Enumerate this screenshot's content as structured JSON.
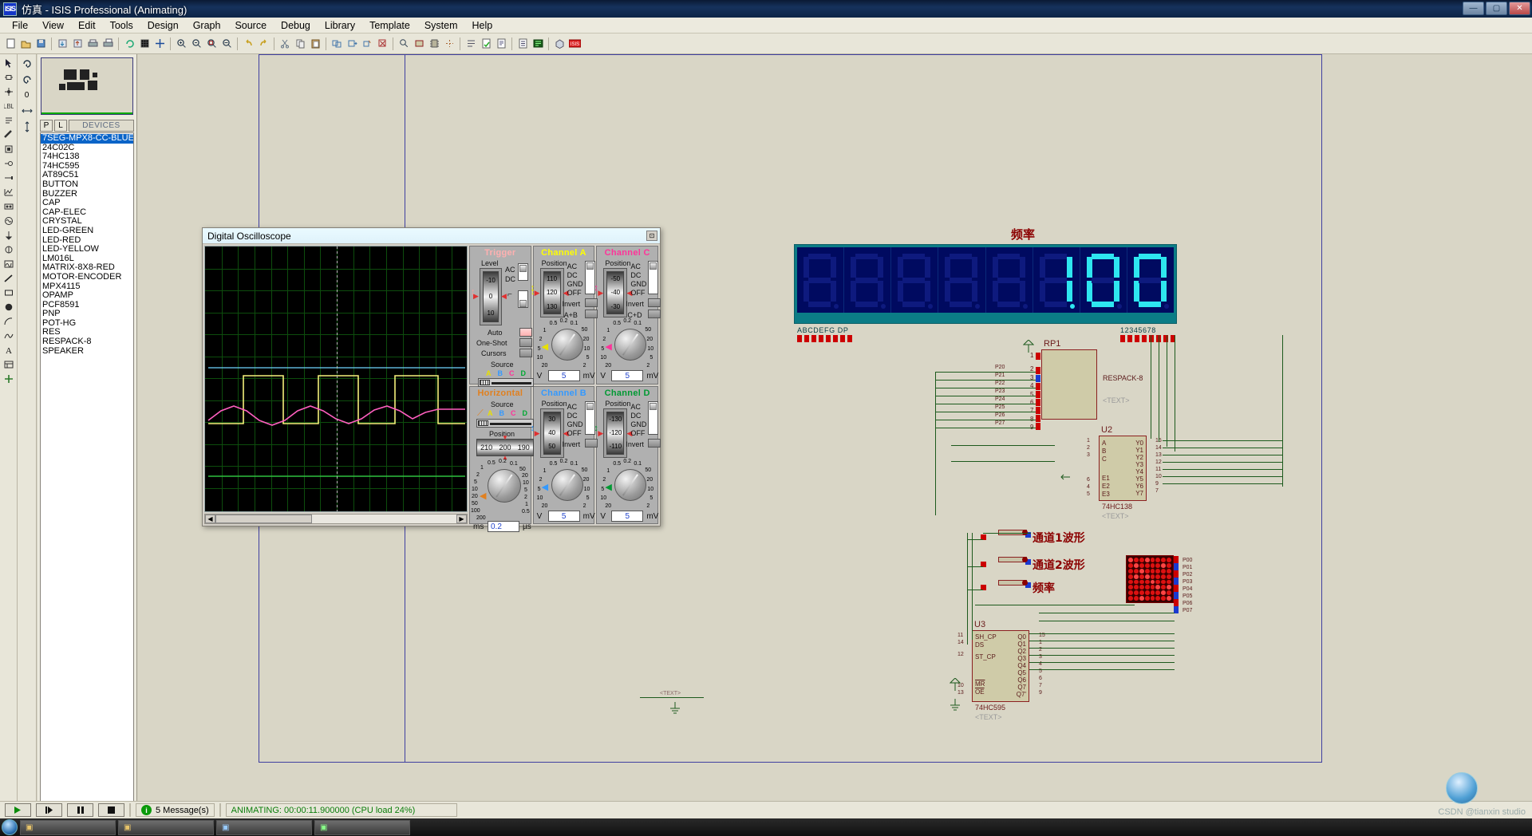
{
  "window": {
    "title": "仿真 - ISIS Professional (Animating)",
    "app_icon": "isis-icon",
    "minimize": "—",
    "maximize": "▢",
    "close": "✕"
  },
  "menubar": {
    "items": [
      "File",
      "View",
      "Edit",
      "Tools",
      "Design",
      "Graph",
      "Source",
      "Debug",
      "Library",
      "Template",
      "System",
      "Help"
    ]
  },
  "toolbar": {
    "groups": [
      [
        "new-file-icon",
        "open-file-icon",
        "save-file-icon"
      ],
      [
        "import-icon",
        "export-icon",
        "print-icon",
        "print-area-icon"
      ],
      [
        "refresh-icon",
        "grid-icon",
        "origin-icon"
      ],
      [
        "zoom-in-icon",
        "zoom-out-icon",
        "zoom-area-icon",
        "zoom-all-icon"
      ],
      [
        "undo-icon",
        "redo-icon"
      ],
      [
        "cut-icon",
        "copy-icon",
        "paste-icon"
      ],
      [
        "block-copy-icon",
        "block-move-icon",
        "block-rotate-icon",
        "block-delete-icon"
      ],
      [
        "pick-device-icon",
        "make-device-icon",
        "packaging-icon",
        "decompose-icon"
      ],
      [
        "netlist-icon",
        "electrical-check-icon",
        "netlist-compile-icon"
      ],
      [
        "bom-icon",
        "ares-icon",
        "help-icon"
      ],
      [
        "3d-view-icon",
        "isis-logo-icon"
      ]
    ]
  },
  "left_toolstrip": {
    "items": [
      "selection-mode-icon",
      "component-mode-icon",
      "junction-dot-icon",
      "wire-label-icon",
      "text-script-icon",
      "bus-icon",
      "subcircuit-icon",
      "terminals-mode-icon",
      "device-pin-icon",
      "graph-mode-icon",
      "tape-recorder-icon",
      "generator-mode-icon",
      "voltage-probe-icon",
      "current-probe-icon",
      "virtual-instrument-icon",
      "line-tool-icon",
      "box-tool-icon",
      "circle-tool-icon",
      "arc-tool-icon",
      "path-tool-icon",
      "text-tool-icon",
      "symbol-tool-icon",
      "marker-tool-icon"
    ],
    "orient_items": [
      "rotate-cw-icon",
      "rotate-ccw-icon",
      "rotation-value",
      "mirror-x-icon",
      "mirror-y-icon"
    ],
    "rotation_value": "0"
  },
  "devices_panel": {
    "header": {
      "p_button": "P",
      "l_button": "L",
      "title": "DEVICES"
    },
    "items": [
      {
        "label": "7SEG-MPX8-CC-BLUE",
        "selected": true
      },
      {
        "label": "24C02C",
        "selected": false
      },
      {
        "label": "74HC138",
        "selected": false
      },
      {
        "label": "74HC595",
        "selected": false
      },
      {
        "label": "AT89C51",
        "selected": false
      },
      {
        "label": "BUTTON",
        "selected": false
      },
      {
        "label": "BUZZER",
        "selected": false
      },
      {
        "label": "CAP",
        "selected": false
      },
      {
        "label": "CAP-ELEC",
        "selected": false
      },
      {
        "label": "CRYSTAL",
        "selected": false
      },
      {
        "label": "LED-GREEN",
        "selected": false
      },
      {
        "label": "LED-RED",
        "selected": false
      },
      {
        "label": "LED-YELLOW",
        "selected": false
      },
      {
        "label": "LM016L",
        "selected": false
      },
      {
        "label": "MATRIX-8X8-RED",
        "selected": false
      },
      {
        "label": "MOTOR-ENCODER",
        "selected": false
      },
      {
        "label": "MPX4115",
        "selected": false
      },
      {
        "label": "OPAMP",
        "selected": false
      },
      {
        "label": "PCF8591",
        "selected": false
      },
      {
        "label": "PNP",
        "selected": false
      },
      {
        "label": "POT-HG",
        "selected": false
      },
      {
        "label": "RES",
        "selected": false
      },
      {
        "label": "RESPACK-8",
        "selected": false
      },
      {
        "label": "SPEAKER",
        "selected": false
      }
    ]
  },
  "schematic": {
    "display_label": "频率",
    "seven_seg": {
      "value": "100",
      "digit_count": 8,
      "pin_label_left": "ABCDEFG DP",
      "pin_label_right": "12345678"
    },
    "labels": [
      {
        "text": "通道1波形"
      },
      {
        "text": "通道2波形"
      },
      {
        "text": "频率"
      }
    ],
    "components": [
      {
        "ref": "RP1",
        "type": "RESPACK-8",
        "text": "<TEXT>",
        "left_pins": [
          "1",
          "2",
          "3",
          "4",
          "5",
          "6",
          "7",
          "8",
          "9"
        ],
        "net_labels": [
          "P20",
          "P21",
          "P22",
          "P23",
          "P24",
          "P25",
          "P26",
          "P27"
        ]
      },
      {
        "ref": "U2",
        "type": "74HC138",
        "text": "<TEXT>",
        "in_pins": [
          "A",
          "B",
          "C",
          "E1",
          "E2",
          "E3"
        ],
        "in_nums": [
          "1",
          "2",
          "3",
          "6",
          "4",
          "5"
        ],
        "out_pins": [
          "Y0",
          "Y1",
          "Y2",
          "Y3",
          "Y4",
          "Y5",
          "Y6",
          "Y7"
        ],
        "out_nums": [
          "15",
          "14",
          "13",
          "12",
          "11",
          "10",
          "9",
          "7"
        ]
      },
      {
        "ref": "U3",
        "type": "74HC595",
        "text": "<TEXT>",
        "in_pins": [
          "SH_CP",
          "DS",
          "ST_CP",
          "MR",
          "OE"
        ],
        "in_nums": [
          "11",
          "14",
          "12",
          "10",
          "13"
        ],
        "out_pins": [
          "Q0",
          "Q1",
          "Q2",
          "Q3",
          "Q4",
          "Q5",
          "Q6",
          "Q7",
          "Q7'"
        ],
        "out_nums": [
          "15",
          "1",
          "2",
          "3",
          "4",
          "5",
          "6",
          "7",
          "9"
        ]
      }
    ],
    "net_labels_right": [
      "P00",
      "P01",
      "P02",
      "P03",
      "P04",
      "P05",
      "P06",
      "P07"
    ]
  },
  "oscilloscope": {
    "title": "Digital Oscilloscope",
    "close_button": "⊡",
    "screen": {
      "grid_cols": 16,
      "grid_rows": 12,
      "trace_colors": {
        "channel_a": "#f5f07a",
        "channel_b": "#6fd6ff",
        "channel_c": "#ff5fc0",
        "channel_d": "#2fbf3f"
      }
    },
    "trigger": {
      "header": "Trigger",
      "level_label": "Level",
      "level_ticks": [
        "-10",
        "0",
        "10"
      ],
      "coupling": [
        "AC",
        "DC"
      ],
      "auto_label": "Auto",
      "one_shot_label": "One-Shot",
      "cursors_label": "Cursors",
      "source_label": "Source",
      "source_channels": [
        "A",
        "B",
        "C",
        "D"
      ]
    },
    "horizontal": {
      "header": "Horizontal",
      "source_label": "Source",
      "source_channels": [
        "A",
        "B",
        "C",
        "D"
      ],
      "position_label": "Position",
      "position_ticks": [
        "210",
        "200",
        "190"
      ],
      "unit_left": "ms",
      "value": "0.2",
      "unit_right": "µs",
      "knob_scale": [
        "0.5",
        "0.2",
        "0.1",
        "1",
        "2",
        "5",
        "10",
        "20",
        "50",
        "100",
        "200",
        "50",
        "20",
        "10",
        "5",
        "2",
        "1",
        "0.5"
      ]
    },
    "channels": [
      {
        "name": "Channel A",
        "color": "#ffff00",
        "position_label": "Position",
        "position_ticks": [
          "110",
          "120",
          "130"
        ],
        "coupling": [
          "AC",
          "DC",
          "GND",
          "OFF"
        ],
        "invert_label": "Invert",
        "extra_label": "A+B",
        "unit_left": "V",
        "value": "5",
        "unit_right": "mV"
      },
      {
        "name": "Channel C",
        "color": "#ff3399",
        "position_label": "Position",
        "position_ticks": [
          "-50",
          "-40",
          "-30"
        ],
        "coupling": [
          "AC",
          "DC",
          "GND",
          "OFF"
        ],
        "invert_label": "Invert",
        "extra_label": "C+D",
        "unit_left": "V",
        "value": "5",
        "unit_right": "mV"
      },
      {
        "name": "Channel B",
        "color": "#3399ff",
        "position_label": "Position",
        "position_ticks": [
          "30",
          "40",
          "50"
        ],
        "coupling": [
          "AC",
          "DC",
          "GND",
          "OFF"
        ],
        "invert_label": "Invert",
        "extra_label": "",
        "unit_left": "V",
        "value": "5",
        "unit_right": "mV"
      },
      {
        "name": "Channel D",
        "color": "#009933",
        "position_label": "Position",
        "position_ticks": [
          "-130",
          "-120",
          "-110"
        ],
        "coupling": [
          "AC",
          "DC",
          "GND",
          "OFF"
        ],
        "invert_label": "Invert",
        "extra_label": "",
        "unit_left": "V",
        "value": "5",
        "unit_right": "mV"
      }
    ],
    "channel_knob_scale": [
      "0.5",
      "0.2",
      "0.1",
      "1",
      "2",
      "5",
      "10",
      "20",
      "50",
      "20",
      "10",
      "5",
      "2"
    ]
  },
  "statusbar": {
    "play_button": "▶",
    "step_button": "▐▶",
    "pause_button": "▐▐",
    "stop_button": "■",
    "messages": "5 Message(s)",
    "animating": "ANIMATING: 00:00:11.900000 (CPU load 24%)"
  },
  "taskbar": {
    "watermark": "CSDN @tianxin studio",
    "items": [
      "",
      "",
      "",
      ""
    ]
  }
}
